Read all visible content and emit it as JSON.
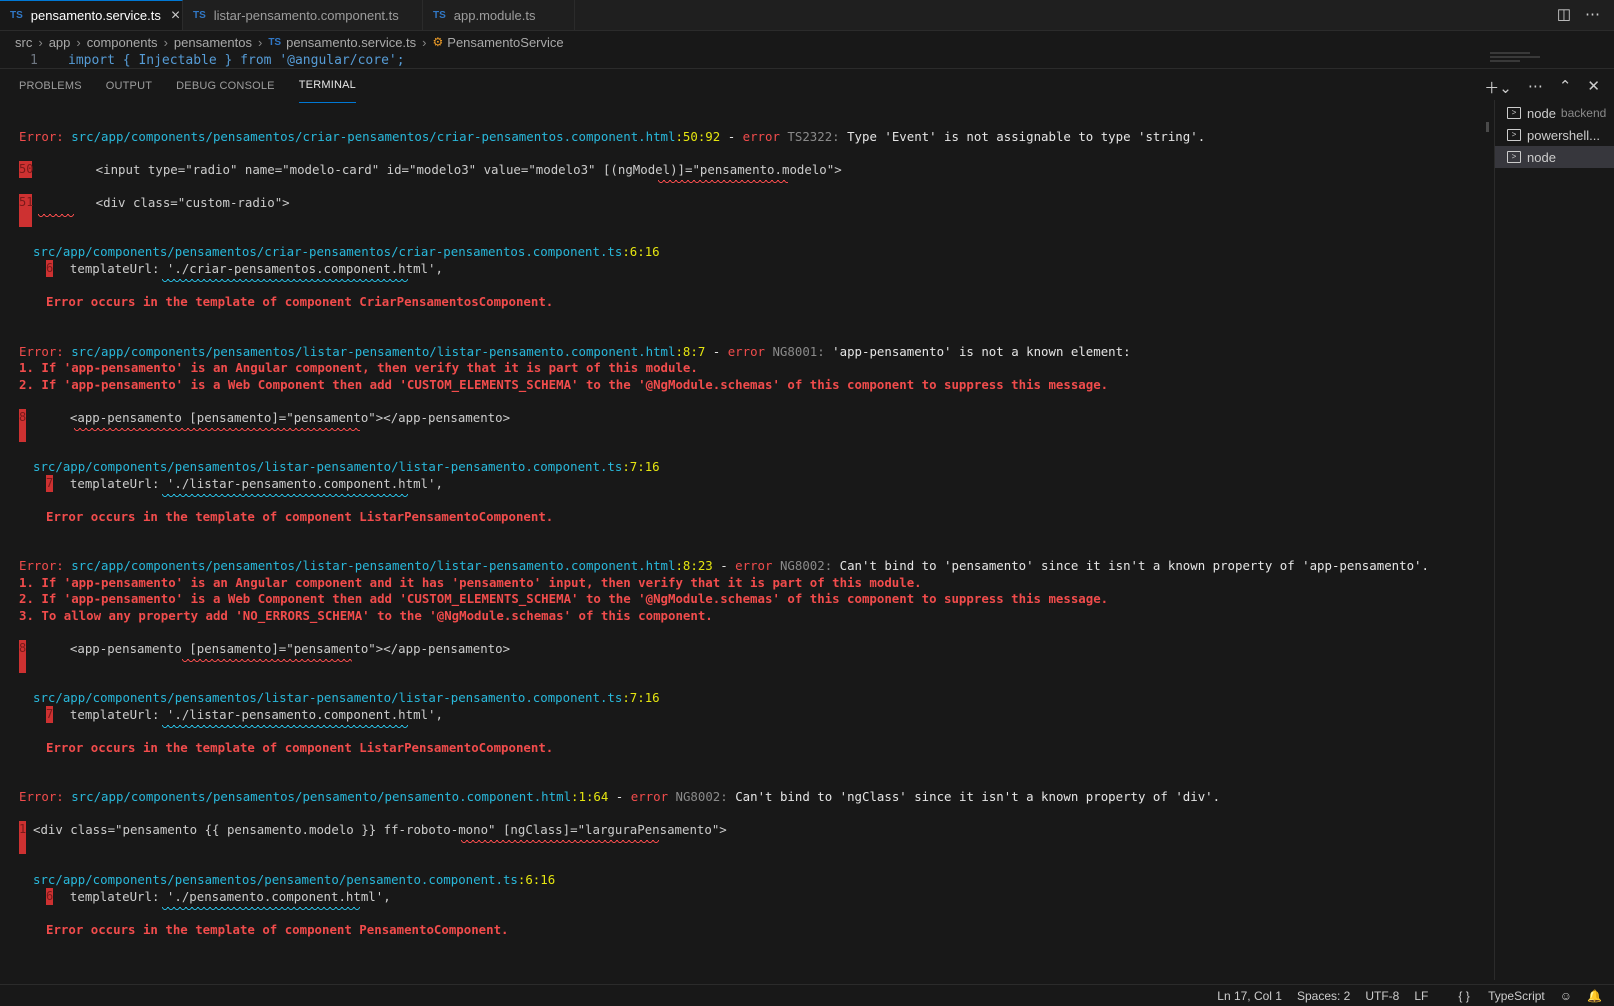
{
  "tabs": [
    {
      "label": "pensamento.service.ts",
      "active": true
    },
    {
      "label": "listar-pensamento.component.ts",
      "active": false
    },
    {
      "label": "app.module.ts",
      "active": false
    }
  ],
  "tab_icon_text": "TS",
  "breadcrumb": [
    "src",
    "app",
    "components",
    "pensamentos",
    "pensamento.service.ts",
    "PensamentoService"
  ],
  "editor": {
    "line_number": "1",
    "code": "import { Injectable } from '@angular/core';"
  },
  "panel_tabs": [
    "PROBLEMS",
    "OUTPUT",
    "DEBUG CONSOLE",
    "TERMINAL"
  ],
  "terminals": [
    {
      "name": "node",
      "sub": "backend"
    },
    {
      "name": "powershell...",
      "sub": ""
    },
    {
      "name": "node",
      "sub": ""
    }
  ],
  "errors": {
    "e1": {
      "prefix": "Error: ",
      "path": "src/app/components/pensamentos/criar-pensamentos/criar-pensamentos.component.html",
      "loc": ":50:92",
      "dash": " - ",
      "err": "error",
      "code": " TS2322: ",
      "msg": "Type 'Event' is not assignable to type 'string'.",
      "l1_num": "50",
      "l1_text": "        <input type=\"radio\" name=\"modelo-card\" id=\"modelo3\" value=\"modelo3\" [(ngModel)]=\"pensamento.modelo\">",
      "l2_num": "51",
      "l2_text": "        <div class=\"custom-radio\">",
      "ref_path": "src/app/components/pensamentos/criar-pensamentos/criar-pensamentos.component.ts",
      "ref_loc": ":6:16",
      "ref_num": "6",
      "ref_text": "  templateUrl: './criar-pensamentos.component.html',",
      "occurs": "Error occurs in the template of component CriarPensamentosComponent."
    },
    "e2": {
      "prefix": "Error: ",
      "path": "src/app/components/pensamentos/listar-pensamento/listar-pensamento.component.html",
      "loc": ":8:7",
      "dash": " - ",
      "err": "error",
      "code": " NG8001: ",
      "msg": "'app-pensamento' is not a known element:",
      "hint1": "1. If 'app-pensamento' is an Angular component, then verify that it is part of this module.",
      "hint2": "2. If 'app-pensamento' is a Web Component then add 'CUSTOM_ELEMENTS_SCHEMA' to the '@NgModule.schemas' of this component to suppress this message.",
      "l1_num": "8",
      "l1_text": "  <app-pensamento [pensamento]=\"pensamento\"></app-pensamento>",
      "ref_path": "src/app/components/pensamentos/listar-pensamento/listar-pensamento.component.ts",
      "ref_loc": ":7:16",
      "ref_num": "7",
      "ref_text": "  templateUrl: './listar-pensamento.component.html',",
      "occurs": "Error occurs in the template of component ListarPensamentoComponent."
    },
    "e3": {
      "prefix": "Error: ",
      "path": "src/app/components/pensamentos/listar-pensamento/listar-pensamento.component.html",
      "loc": ":8:23",
      "dash": " - ",
      "err": "error",
      "code": " NG8002: ",
      "msg": "Can't bind to 'pensamento' since it isn't a known property of 'app-pensamento'.",
      "hint1": "1. If 'app-pensamento' is an Angular component and it has 'pensamento' input, then verify that it is part of this module.",
      "hint2": "2. If 'app-pensamento' is a Web Component then add 'CUSTOM_ELEMENTS_SCHEMA' to the '@NgModule.schemas' of this component to suppress this message.",
      "hint3": "3. To allow any property add 'NO_ERRORS_SCHEMA' to the '@NgModule.schemas' of this component.",
      "l1_num": "8",
      "l1_text": "  <app-pensamento [pensamento]=\"pensamento\"></app-pensamento>",
      "ref_path": "src/app/components/pensamentos/listar-pensamento/listar-pensamento.component.ts",
      "ref_loc": ":7:16",
      "ref_num": "7",
      "ref_text": "  templateUrl: './listar-pensamento.component.html',",
      "occurs": "Error occurs in the template of component ListarPensamentoComponent."
    },
    "e4": {
      "prefix": "Error: ",
      "path": "src/app/components/pensamentos/pensamento/pensamento.component.html",
      "loc": ":1:64",
      "dash": " - ",
      "err": "error",
      "code": " NG8002: ",
      "msg": "Can't bind to 'ngClass' since it isn't a known property of 'div'.",
      "l1_num": "1",
      "l1_text": "<div class=\"pensamento {{ pensamento.modelo }} ff-roboto-mono\" [ngClass]=\"larguraPensamento\">",
      "ref_path": "src/app/components/pensamentos/pensamento/pensamento.component.ts",
      "ref_loc": ":6:16",
      "ref_num": "6",
      "ref_text": "  templateUrl: './pensamento.component.html',",
      "occurs": "Error occurs in the template of component PensamentoComponent."
    }
  },
  "status": {
    "position": "Ln 17, Col 1",
    "spaces": "Spaces: 2",
    "encoding": "UTF-8",
    "eol": "LF",
    "language_icon": "{ }",
    "language": "TypeScript"
  },
  "colors": {
    "error": "#f14c4c",
    "path": "#29b8db",
    "loc": "#e5e510",
    "accent": "#0078d4",
    "ts": "#3178c6"
  }
}
